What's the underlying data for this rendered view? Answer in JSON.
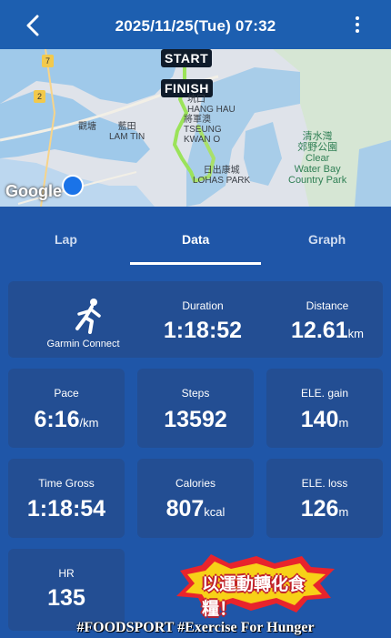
{
  "header": {
    "title": "2025/11/25(Tue) 07:32"
  },
  "map": {
    "start_label": "START",
    "finish_label": "FINISH",
    "places": {
      "hang_hau": "坑口\nHANG HAU",
      "tseung_kwan_o": "將軍澳\nTSEUNG\nKWAN O",
      "lohas_park": "日出康城\nLOHAS PARK",
      "lam_tin": "藍田\nLAM TIN",
      "kwun_tong": "觀塘",
      "clear_water_bay": "清水灣\n郊野公園\nClear\nWater Bay\nCountry Park",
      "route_7": "7",
      "route_2": "2"
    },
    "attribution": "Google"
  },
  "tabs": [
    "Lap",
    "Data",
    "Graph"
  ],
  "active_tab": "Data",
  "stats": {
    "source": "Garmin Connect",
    "duration": {
      "label": "Duration",
      "value": "1:18:52"
    },
    "distance": {
      "label": "Distance",
      "value": "12.61",
      "unit": "km"
    },
    "pace": {
      "label": "Pace",
      "value": "6:16",
      "unit": "/km"
    },
    "steps": {
      "label": "Steps",
      "value": "13592"
    },
    "ele_gain": {
      "label": "ELE. gain",
      "value": "140",
      "unit": "m"
    },
    "time_gross": {
      "label": "Time Gross",
      "value": "1:18:54"
    },
    "calories": {
      "label": "Calories",
      "value": "807",
      "unit": "kcal"
    },
    "ele_loss": {
      "label": "ELE. loss",
      "value": "126",
      "unit": "m"
    },
    "hr": {
      "label": "HR",
      "value": "135"
    }
  },
  "overlay": {
    "badge": "以運動轉化食糧！",
    "footer": "#FOODSPORT #Exercise For Hunger"
  },
  "colors": {
    "background": "#1f56a8",
    "card": "#234e93",
    "route": "#9be35a"
  }
}
